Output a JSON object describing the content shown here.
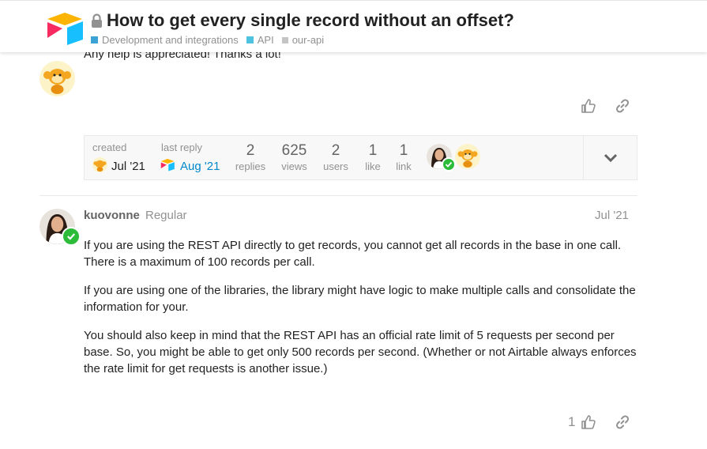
{
  "header": {
    "title": "How to get every single record without an offset?",
    "category": "Development and integrations",
    "category_color": "#3ba2d6",
    "subcategory": "API",
    "subcategory_color": "#4ec3e0",
    "tag": "our-api"
  },
  "first_post": {
    "tail_text": "Any help is appreciated! Thanks a lot!"
  },
  "topic_map": {
    "created_label": "created",
    "created_date": "Jul '21",
    "last_reply_label": "last reply",
    "last_reply_date": "Aug '21",
    "stats": [
      {
        "number": "2",
        "label": "replies"
      },
      {
        "number": "625",
        "label": "views"
      },
      {
        "number": "2",
        "label": "users"
      },
      {
        "number": "1",
        "label": "like"
      },
      {
        "number": "1",
        "label": "link"
      }
    ]
  },
  "post": {
    "username": "kuovonne",
    "user_title": "Regular",
    "date": "Jul '21",
    "paragraphs": [
      "If you are using the REST API directly to get records, you cannot get all records in the base in one call. There is a maximum of 100 records per call.",
      "If you are using one of the libraries, the library might have logic to make multiple calls and consolidate the information for your.",
      "You should also keep in mind that the REST API has an official rate limit of 5 requests per second per base. So, you might be able to get only 500 records per second. (Whether or not Airtable always enforces the rate limit for get requests is another issue.)"
    ],
    "like_count": "1"
  },
  "colors": {
    "accent_link": "#0088cc",
    "flair_green": "#2dbb3a"
  }
}
